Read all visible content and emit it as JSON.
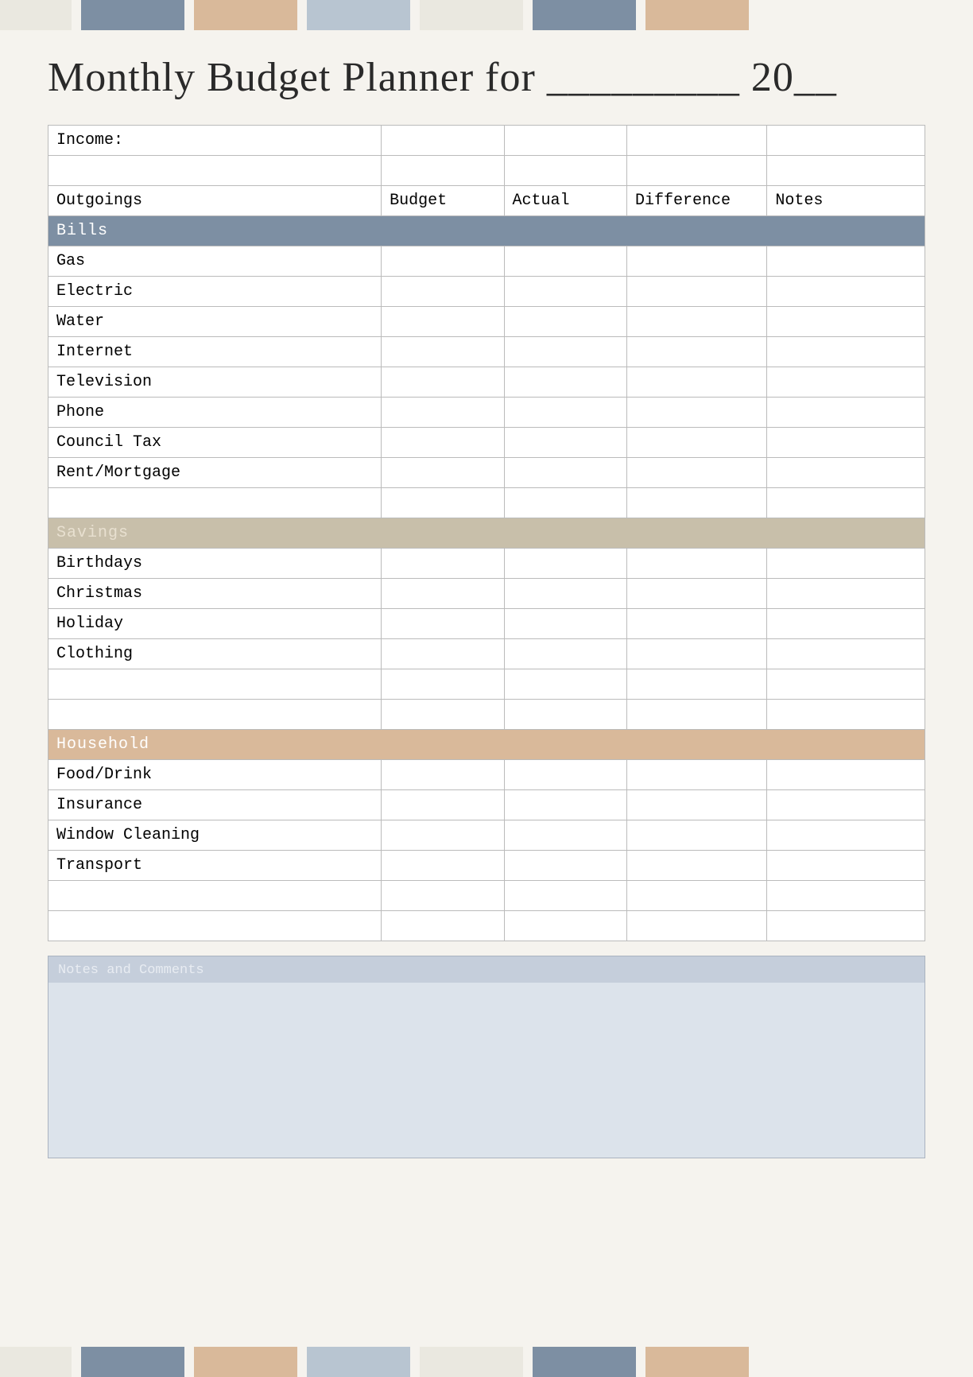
{
  "page": {
    "title": "Monthly Budget Planner for _________ 20__",
    "top_strip_colors": [
      "#eae8e0",
      "#7d8fa3",
      "#d9b99a",
      "#b8c5d1",
      "#eae8e0",
      "#7d8fa3",
      "#d9b99a"
    ],
    "bottom_strip_colors": [
      "#eae8e0",
      "#7d8fa3",
      "#d9b99a",
      "#b8c5d1",
      "#eae8e0",
      "#7d8fa3",
      "#d9b99a"
    ]
  },
  "table": {
    "income_label": "Income:",
    "headers": [
      "Outgoings",
      "Budget",
      "Actual",
      "Difference",
      "Notes"
    ],
    "sections": {
      "bills": {
        "label": "Bills",
        "items": [
          "Gas",
          "Electric",
          "Water",
          "Internet",
          "Television",
          "Phone",
          "Council Tax",
          "Rent/Mortgage"
        ]
      },
      "savings": {
        "label": "Savings",
        "items": [
          "Birthdays",
          "Christmas",
          "Holiday",
          "Clothing"
        ]
      },
      "household": {
        "label": "Household",
        "items": [
          "Food/Drink",
          "Insurance",
          "Window Cleaning",
          "Transport"
        ]
      }
    }
  },
  "notes_section": {
    "header": "Notes and Comments"
  }
}
